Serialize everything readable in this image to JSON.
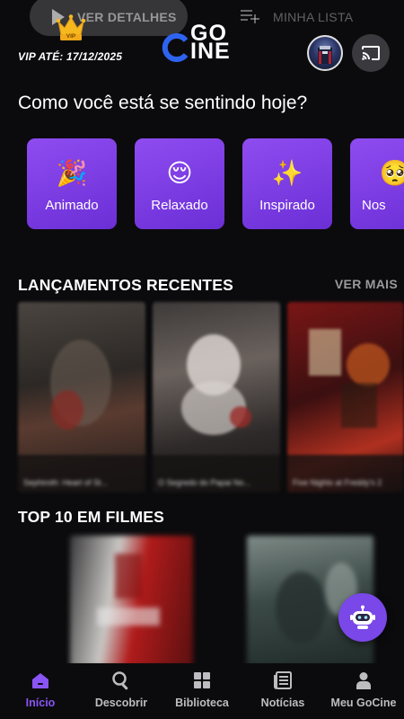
{
  "ghost_bar": {
    "details_label": "VER DETALHES",
    "list_label": "MINHA LISTA"
  },
  "header": {
    "crown_badge": "VIP",
    "vip_until": "VIP ATÉ: 17/12/2025",
    "logo_top": "GO",
    "logo_bottom": "INE"
  },
  "mood": {
    "title": "Como você está se sentindo hoje?",
    "items": [
      {
        "emoji": "🎉",
        "label": "Animado"
      },
      {
        "emoji": "😌",
        "label": "Relaxado"
      },
      {
        "emoji": "✨",
        "label": "Inspirado"
      },
      {
        "emoji": "🥺",
        "label": "Nos"
      }
    ]
  },
  "recent": {
    "title": "LANÇAMENTOS RECENTES",
    "see_more": "VER MAIS",
    "posters": [
      {
        "caption": "Sephiroth: Heart of St...",
        "colors": [
          "#3a3530",
          "#5a4d45",
          "#2a2624"
        ]
      },
      {
        "caption": "O Segredo do Papai No...",
        "colors": [
          "#4a4440",
          "#8a7d78",
          "#3a3431"
        ]
      },
      {
        "caption": "Five Nights at Freddy's 2",
        "colors": [
          "#6e1515",
          "#2a0c0c",
          "#b22222"
        ]
      }
    ]
  },
  "top10": {
    "title": "TOP 10 EM FILMES"
  },
  "nav": {
    "items": [
      {
        "label": "Início",
        "active": true
      },
      {
        "label": "Descobrir",
        "active": false
      },
      {
        "label": "Biblioteca",
        "active": false
      },
      {
        "label": "Notícias",
        "active": false
      },
      {
        "label": "Meu GoCine",
        "active": false
      }
    ]
  },
  "colors": {
    "accent": "#8a55f5",
    "card": "#7a3fe4",
    "background": "#0b0b0d"
  }
}
